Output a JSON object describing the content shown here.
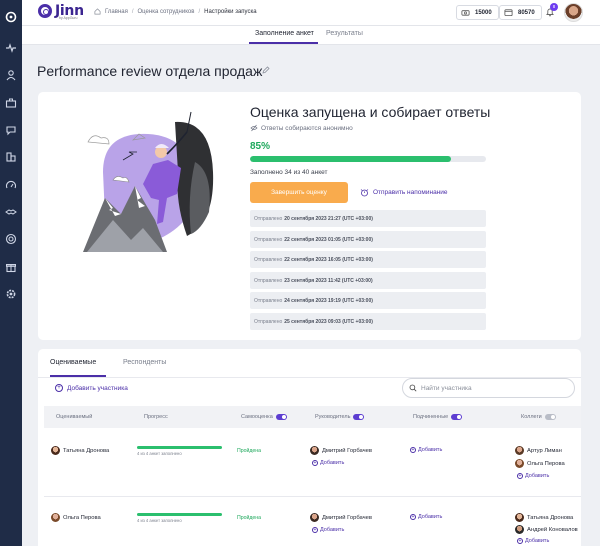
{
  "app": {
    "logo": "Jinn",
    "logo_sub": "by AppGuru"
  },
  "breadcrumb": [
    "Главная",
    "Оценка сотрудников",
    "Настройки запуска"
  ],
  "header": {
    "coins": "15000",
    "points": "80570",
    "notifications": "8"
  },
  "tabs": [
    "Заполнение анкет",
    "Результаты"
  ],
  "page_title": "Performance review отдела продаж",
  "status": {
    "title": "Оценка запущена и собирает ответы",
    "anonymous": "Ответы собираются анонимно",
    "percent_label": "85%",
    "percent": 85,
    "filled": "Заполнено 34 из 40 анкет",
    "finish_button": "Завершить оценку",
    "remind_button": "Отправить напоминание",
    "sent_prefix": "Отправлено",
    "sent": [
      "20 сентября 2023 21:27 (UTC +03:00)",
      "22 сентября 2023 01:05 (UTC +03:00)",
      "22 сентября 2023 16:05 (UTC +03:00)",
      "23 сентября 2023 11:42 (UTC +03:00)",
      "24 сентября 2023 19:19 (UTC +03:00)",
      "25 сентября 2023 09:03 (UTC +03:00)"
    ]
  },
  "participants": {
    "tabs": [
      "Оцениваемые",
      "Респонденты"
    ],
    "add_button": "Добавить участника",
    "search_placeholder": "Найти участника",
    "columns": [
      "Оцениваемый",
      "Прогресс",
      "Самооценка",
      "Руководитель",
      "Подчиненные",
      "Коллеги"
    ],
    "add_label": "Добавить",
    "rows": [
      {
        "name": "Татьяна Дронова",
        "progress_text": "4 из 4 анкет заполнено",
        "self": "Пройдена",
        "manager": "Дмитрий Горбачев",
        "colleagues": [
          "Артур Лиман",
          "Ольга Перова"
        ]
      },
      {
        "name": "Ольга Перова",
        "progress_text": "4 из 4 анкет заполнено",
        "self": "Пройдена",
        "manager": "Дмитрий Горбачев",
        "colleagues": [
          "Татьяна Дронова",
          "Андрей Коновалов"
        ]
      }
    ]
  },
  "colors": {
    "accent": "#4b2fa8",
    "success": "#2bbf6e",
    "warning": "#f9ab4d",
    "sidebar": "#1f2c47"
  }
}
